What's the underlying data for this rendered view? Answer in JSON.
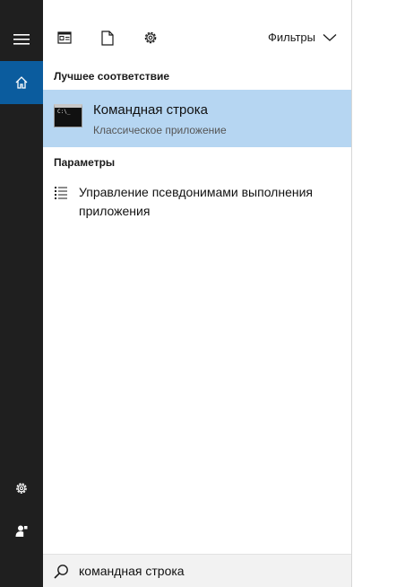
{
  "rail": {
    "items": [
      {
        "icon": "hamburger-menu-icon"
      },
      {
        "icon": "home-icon",
        "active": true
      },
      {
        "icon": "gear-icon"
      },
      {
        "icon": "user-icon"
      }
    ]
  },
  "toolbar": {
    "icons": [
      "document-view-icon",
      "file-icon",
      "gear-icon"
    ],
    "filters_label": "Фильтры"
  },
  "best_match": {
    "section_title": "Лучшее соответствие",
    "title": "Командная строка",
    "subtitle": "Классическое приложение",
    "icon_prompt": "C:\\_"
  },
  "settings": {
    "section_title": "Параметры",
    "items": [
      {
        "label": "Управление псевдонимами выполнения приложения",
        "icon": "list-settings-icon"
      }
    ]
  },
  "search": {
    "value": "командная строка"
  },
  "colors": {
    "rail_bg": "#1f1f1f",
    "rail_active": "#0b5c9e",
    "selection": "#b6d6f2"
  }
}
